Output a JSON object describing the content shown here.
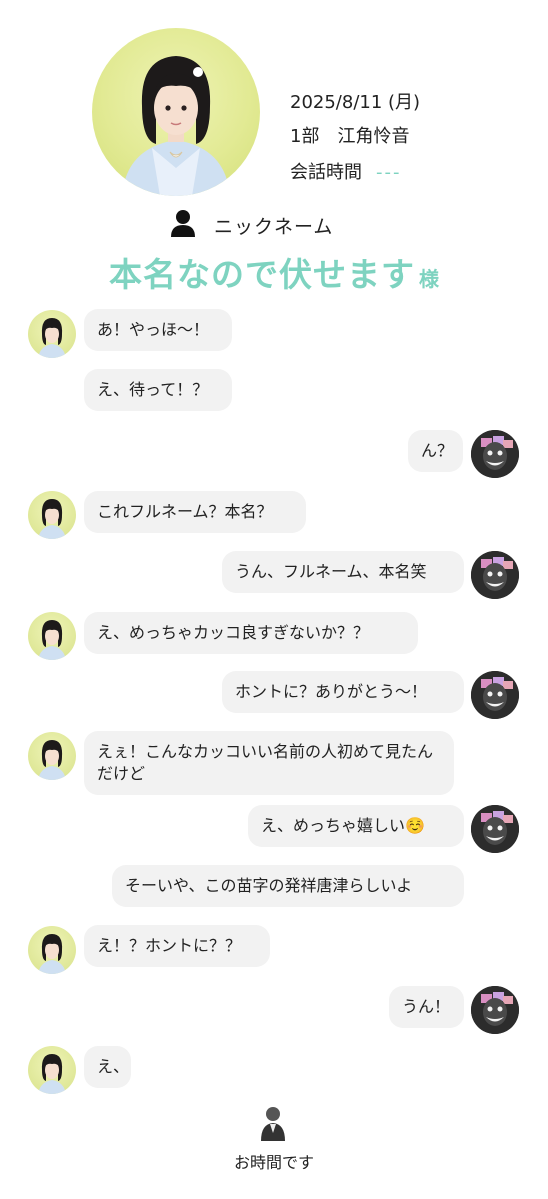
{
  "header": {
    "date": "2025/8/11 (月)",
    "slot": "1部　江角怜音",
    "duration_label": "会話時間",
    "duration_value": "---"
  },
  "nickname": {
    "icon": "person-icon",
    "label": "ニックネーム",
    "name": "本名なので伏せます",
    "honorific": "様"
  },
  "colors": {
    "accent": "#7ed3c0",
    "bubble": "#f2f2f2"
  },
  "messages": [
    {
      "from": "idol",
      "text": "あ！やっほ〜！"
    },
    {
      "from": "idol",
      "text": "え、待って！？"
    },
    {
      "from": "fan",
      "text": "ん？"
    },
    {
      "from": "idol",
      "text": "これフルネーム？本名？"
    },
    {
      "from": "fan",
      "text": "うん、フルネーム、本名笑"
    },
    {
      "from": "idol",
      "text": "え、めっちゃカッコ良すぎないか？？"
    },
    {
      "from": "fan",
      "text": "ホントに？ありがとう〜！"
    },
    {
      "from": "idol",
      "text": "えぇ！こんなカッコいい名前の人初めて見たんだけど"
    },
    {
      "from": "fan",
      "text": "え、めっちゃ嬉しい☺️"
    },
    {
      "from": "fan",
      "text": "そーいや、この苗字の発祥唐津らしいよ"
    },
    {
      "from": "idol",
      "text": "え！？ホントに？？"
    },
    {
      "from": "fan",
      "text": "うん！"
    },
    {
      "from": "idol",
      "text": "え、"
    }
  ],
  "footer": {
    "icon": "person-bust-icon",
    "label": "お時間です"
  }
}
